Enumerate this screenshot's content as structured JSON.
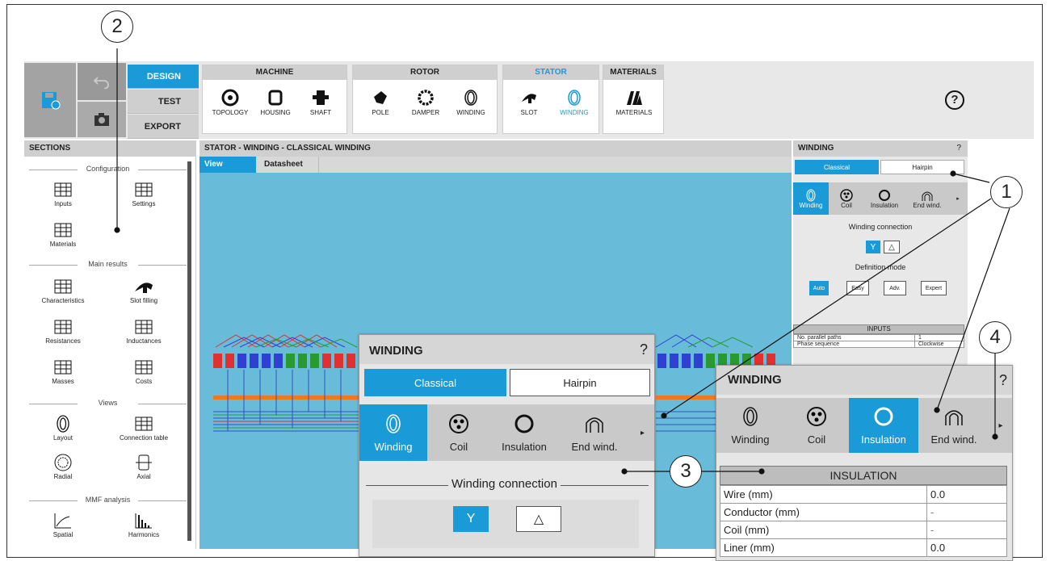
{
  "callouts": [
    "1",
    "2",
    "3",
    "4"
  ],
  "toolbar": {
    "modes": [
      "DESIGN",
      "TEST",
      "EXPORT"
    ],
    "groups": [
      {
        "title": "MACHINE",
        "tools": [
          "TOPOLOGY",
          "HOUSING",
          "SHAFT"
        ]
      },
      {
        "title": "ROTOR",
        "tools": [
          "POLE",
          "DAMPER",
          "WINDING"
        ]
      },
      {
        "title": "STATOR",
        "tools": [
          "SLOT",
          "WINDING"
        ]
      },
      {
        "title": "MATERIALS",
        "tools": [
          "MATERIALS"
        ]
      }
    ],
    "help": "?"
  },
  "sections": {
    "title": "SECTIONS",
    "groups": [
      "Configuration",
      "Main results",
      "Views",
      "MMF analysis"
    ],
    "items": [
      "Inputs",
      "Settings",
      "Materials",
      "Characteristics",
      "Slot filling",
      "Resistances",
      "Inductances",
      "Masses",
      "Costs",
      "Layout",
      "Connection table",
      "Radial",
      "Axial",
      "Spatial",
      "Harmonics"
    ]
  },
  "main": {
    "title": "STATOR - WINDING - CLASSICAL WINDING",
    "tabs": [
      "View",
      "Datasheet"
    ]
  },
  "right_panel": {
    "title": "WINDING",
    "help": "?",
    "modes": [
      "Classical",
      "Hairpin"
    ],
    "icons": [
      "Winding",
      "Coil",
      "Insulation",
      "End wind."
    ],
    "winding_connection": "Winding connection",
    "connection_options": [
      "Y",
      "△"
    ],
    "definition_mode": "Definition mode",
    "definition_options": [
      "Auto",
      "Easy",
      "Adv.",
      "Expert"
    ],
    "inputs_title": "INPUTS",
    "inputs": [
      [
        "No. parallel paths",
        "1"
      ],
      [
        "Phase sequence",
        "Clockwise"
      ]
    ]
  },
  "popup1": {
    "title": "WINDING",
    "help": "?",
    "modes": [
      "Classical",
      "Hairpin"
    ],
    "icons": [
      "Winding",
      "Coil",
      "Insulation",
      "End wind."
    ],
    "winding_connection": "Winding connection",
    "connection_options": [
      "Y",
      "△"
    ]
  },
  "popup2": {
    "title": "WINDING",
    "help": "?",
    "icons": [
      "Winding",
      "Coil",
      "Insulation",
      "End wind."
    ],
    "table_title": "INSULATION",
    "rows": [
      [
        "Wire (mm)",
        "0.0"
      ],
      [
        "Conductor (mm)",
        "-"
      ],
      [
        "Coil (mm)",
        "-"
      ],
      [
        "Liner (mm)",
        "0.0"
      ]
    ]
  }
}
